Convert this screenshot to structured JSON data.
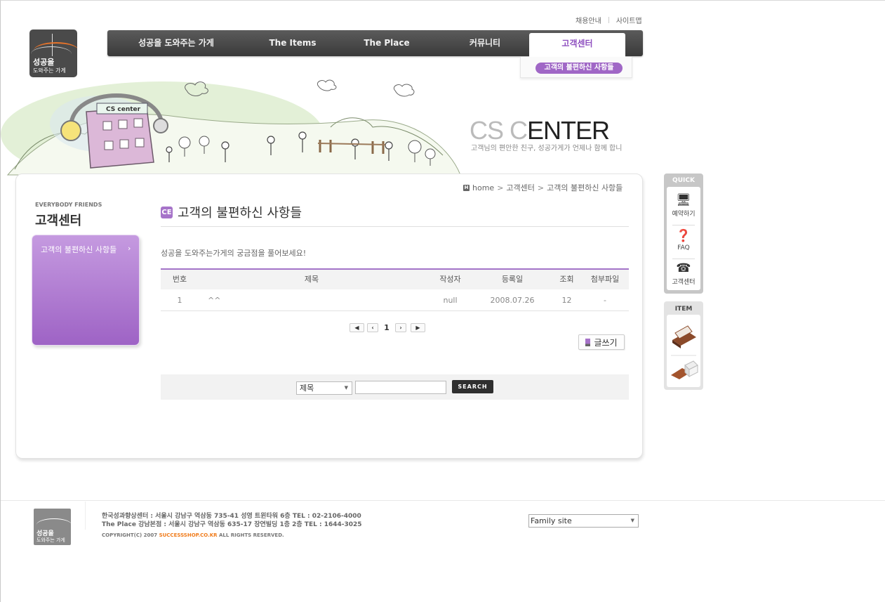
{
  "util_links": [
    "채용안내",
    "사이트맵"
  ],
  "logo": {
    "line1": "성공을",
    "line2": "도와주는 가게"
  },
  "gnb": {
    "items": [
      "성공을 도와주는 가게",
      "The Items",
      "The Place",
      "커뮤니티",
      "고객센터"
    ],
    "active_index": 4,
    "sub_item": "고객의 불편하신 사항들"
  },
  "hero": {
    "badge": "CS center",
    "title_light": "CS C",
    "title_dark": "ENTER",
    "subtitle": "고객님의 편안한 친구, 성공가게가 언제나 함께 합니"
  },
  "sidebar": {
    "eyebrow": "EVERYBODY FRIENDS",
    "title": "고객센터",
    "menu_item": "고객의 불편하신 사항들",
    "chevron": "›"
  },
  "breadcrumb": {
    "home_badge": "H",
    "items": [
      "home",
      "고객센터",
      "고객의 불편하신 사항들"
    ],
    "sep": ">"
  },
  "page": {
    "icon_text": "CE",
    "title": "고객의 불편하신 사항들",
    "intro": "성공을 도와주는가게의 궁금점을 풀어보세요!"
  },
  "table": {
    "columns": [
      "번호",
      "제목",
      "작성자",
      "등록일",
      "조회",
      "첨부파일"
    ],
    "rows": [
      {
        "no": "1",
        "title": "^^",
        "author": "null",
        "date": "2008.07.26",
        "views": "12",
        "file": "-"
      }
    ]
  },
  "pager": {
    "first": "◀",
    "prev": "‹",
    "current": "1",
    "next": "›",
    "last": "▶"
  },
  "write_button": "글쓰기",
  "search": {
    "field_selected": "제목",
    "button": "SEARCH",
    "value": ""
  },
  "quick": {
    "header": "QUICK",
    "items": [
      {
        "label": "예약하기",
        "icon": "monitor-icon"
      },
      {
        "label": "FAQ",
        "icon": "question-icon"
      },
      {
        "label": "고객센터",
        "icon": "phone-icon"
      }
    ]
  },
  "item_box": {
    "header": "ITEM"
  },
  "footer": {
    "line1": "한국성과향상센터 : 서울시 강남구 역삼동 735-41 성영 트윈타워 6층 TEL : 02-2106-4000",
    "line2": "The Place 강남본점 : 서울시 강남구 역삼동 635-17 장연빌딩 1층 2층 TEL : 1644-3025",
    "copy_pre": "COPYRIGHT(C) 2007",
    "copy_brand": "SUCCESSSHOP.CO.KR",
    "copy_post": "ALL RIGHTS RESERVED.",
    "family_site": "Family site"
  },
  "colors": {
    "accent": "#a067c6",
    "nav": "#4a4a4a",
    "footer_brand": "#f07b1a"
  }
}
